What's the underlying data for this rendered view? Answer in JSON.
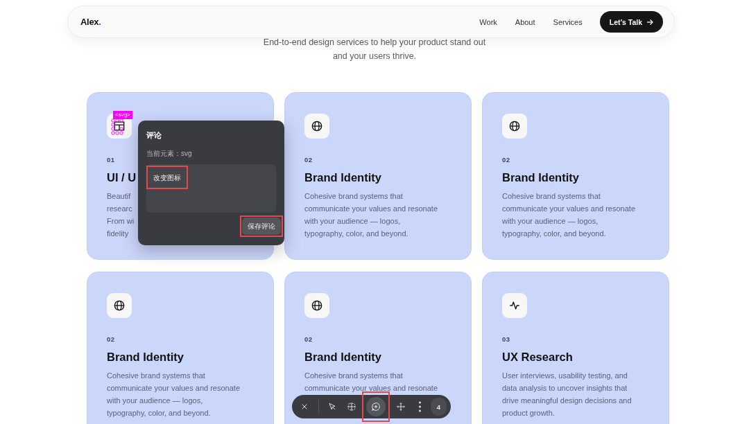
{
  "nav": {
    "logo": {
      "text": "Alex",
      "dot": "."
    },
    "links": [
      "Work",
      "About",
      "Services"
    ],
    "cta": "Let’s Talk"
  },
  "subtitle": "End-to-end design services to help your product stand out and your users thrive.",
  "cards": [
    {
      "kind": "layout",
      "selected": true,
      "tag": "<svg>",
      "number": "01",
      "title": "UI / U",
      "lines": [
        "Beautif",
        "researc",
        "From wi",
        "fidelity"
      ]
    },
    {
      "kind": "globe",
      "selected": false,
      "number": "02",
      "title": "Brand Identity",
      "lines": [
        "Cohesive brand systems that",
        "communicate your values and resonate",
        "with your audience — logos,",
        "typography, color, and beyond."
      ]
    },
    {
      "kind": "globe",
      "selected": false,
      "number": "02",
      "title": "Brand Identity",
      "lines": [
        "Cohesive brand systems that",
        "communicate your values and resonate",
        "with your audience — logos,",
        "typography, color, and beyond."
      ]
    },
    {
      "kind": "globe",
      "selected": false,
      "number": "02",
      "title": "Brand Identity",
      "lines": [
        "Cohesive brand systems that",
        "communicate your values and resonate",
        "with your audience — logos,",
        "typography, color, and beyond."
      ]
    },
    {
      "kind": "globe",
      "selected": false,
      "number": "02",
      "title": "Brand Identity",
      "lines": [
        "Cohesive brand systems that",
        "communicate your values and resonate"
      ]
    },
    {
      "kind": "pulse",
      "selected": false,
      "number": "03",
      "title": "UX Research",
      "lines": [
        "User interviews, usability testing, and",
        "data analysis to uncover insights that",
        "drive meaningful design decisions and",
        "product growth."
      ]
    }
  ],
  "comment_popup": {
    "title": "评论",
    "element_label": "当前元素：svg",
    "value": "改变图标",
    "value_highlighted": true,
    "save_button": "保存评论",
    "save_highlighted": true
  },
  "toolbar": {
    "tools": [
      {
        "kind": "close",
        "selected": false,
        "highlighted": false
      },
      {
        "kind": "select",
        "selected": false,
        "highlighted": false
      },
      {
        "kind": "frame",
        "selected": false,
        "highlighted": false
      },
      {
        "kind": "comment",
        "selected": true,
        "highlighted": true
      },
      {
        "kind": "move",
        "selected": false,
        "highlighted": false
      },
      {
        "kind": "more",
        "selected": false,
        "highlighted": false
      }
    ],
    "count": "4"
  }
}
